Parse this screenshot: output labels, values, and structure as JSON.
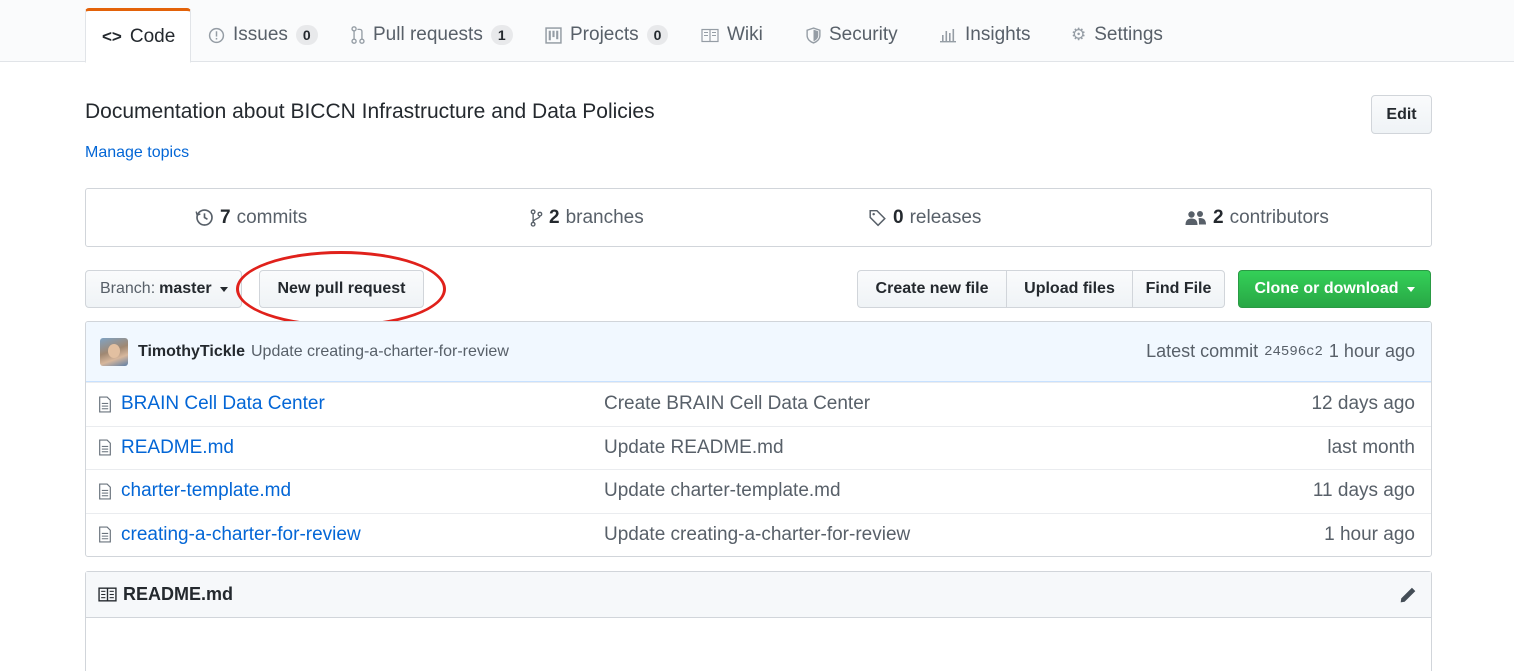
{
  "tabs": [
    {
      "label": "Code",
      "icon": "code-icon",
      "selected": true
    },
    {
      "label": "Issues",
      "icon": "issue-icon",
      "count": "0"
    },
    {
      "label": "Pull requests",
      "icon": "pull-request-icon",
      "count": "1"
    },
    {
      "label": "Projects",
      "icon": "project-icon",
      "count": "0"
    },
    {
      "label": "Wiki",
      "icon": "book-icon"
    },
    {
      "label": "Security",
      "icon": "shield-icon"
    },
    {
      "label": "Insights",
      "icon": "graph-icon"
    },
    {
      "label": "Settings",
      "icon": "gear-icon"
    }
  ],
  "repo": {
    "description": "Documentation about BICCN Infrastructure and Data Policies",
    "manage_topics": "Manage topics",
    "edit_label": "Edit"
  },
  "summary": {
    "commits": {
      "count": "7",
      "label": "commits"
    },
    "branches": {
      "count": "2",
      "label": "branches"
    },
    "releases": {
      "count": "0",
      "label": "releases"
    },
    "contributors": {
      "count": "2",
      "label": "contributors"
    }
  },
  "toolbar": {
    "branch_prefix": "Branch:",
    "branch_name": "master",
    "new_pr": "New pull request",
    "create_file": "Create new file",
    "upload_files": "Upload files",
    "find_file": "Find File",
    "clone": "Clone or download"
  },
  "latest_commit": {
    "author": "TimothyTickle",
    "message": "Update creating-a-charter-for-review",
    "prefix": "Latest commit",
    "sha": "24596c2",
    "age": "1 hour ago"
  },
  "files": [
    {
      "name": "BRAIN Cell Data Center",
      "message": "Create BRAIN Cell Data Center",
      "age": "12 days ago"
    },
    {
      "name": "README.md",
      "message": "Update README.md",
      "age": "last month"
    },
    {
      "name": "charter-template.md",
      "message": "Update charter-template.md",
      "age": "11 days ago"
    },
    {
      "name": "creating-a-charter-for-review",
      "message": "Update creating-a-charter-for-review",
      "age": "1 hour ago"
    }
  ],
  "readme": {
    "title": "README.md"
  },
  "colors": {
    "accent_tab": "#e36209",
    "link": "#0366d6",
    "clone_green": "#28a745",
    "annotation_red": "#e0211b"
  }
}
